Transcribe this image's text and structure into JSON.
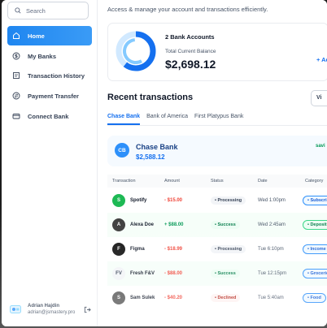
{
  "sidebar": {
    "search_placeholder": "Search",
    "items": [
      {
        "label": "Home",
        "icon": "home-icon"
      },
      {
        "label": "My Banks",
        "icon": "dollar-circle-icon"
      },
      {
        "label": "Transaction History",
        "icon": "receipt-icon"
      },
      {
        "label": "Payment Transfer",
        "icon": "transfer-icon"
      },
      {
        "label": "Connect Bank",
        "icon": "bank-card-icon"
      }
    ],
    "user": {
      "name": "Adrian Hajdin",
      "email": "adrian@jsmastery.pro"
    }
  },
  "header": {
    "subtitle": "Access & manage your account and transactions efficiently."
  },
  "balance_card": {
    "accounts_label": "2 Bank Accounts",
    "total_label": "Total Current Balance",
    "total": "$2,698.12",
    "add_bank": "+ Add"
  },
  "recent": {
    "title": "Recent transactions",
    "view_all": "Vi",
    "tabs": [
      "Chase Bank",
      "Bank of America",
      "First Platypus Bank"
    ],
    "bank": {
      "initials": "CB",
      "name": "Chase Bank",
      "balance": "$2,588.12",
      "type": "savi"
    },
    "columns": [
      "Transaction",
      "Amount",
      "Status",
      "Date",
      "Category"
    ],
    "rows": [
      {
        "name": "Spotify",
        "amount": "- $15.00",
        "status": "• Processing",
        "date": "Wed 1:00pm",
        "category": "• Subscrip",
        "avatar": "S",
        "avatar_color": "#1db954"
      },
      {
        "name": "Alexa Doe",
        "amount": "+ $88.00",
        "status": "• Success",
        "date": "Wed 2:45am",
        "category": "• Deposit",
        "avatar": "A",
        "avatar_color": "#3a3a3a"
      },
      {
        "name": "Figma",
        "amount": "- $18.99",
        "status": "• Processing",
        "date": "Tue 6:10pm",
        "category": "• Income",
        "avatar": "F",
        "avatar_color": "#111111"
      },
      {
        "name": "Fresh F&V",
        "amount": "- $88.00",
        "status": "• Success",
        "date": "Tue 12:15pm",
        "category": "• Groceries",
        "avatar": "FV",
        "avatar_color": "#f2f4f7"
      },
      {
        "name": "Sam Sulek",
        "amount": "- $40.20",
        "status": "• Declined",
        "date": "Tue 5:40am",
        "category": "• Food",
        "avatar": "S",
        "avatar_color": "#5a5a5a"
      }
    ]
  },
  "colors": {
    "accent": "#1570ef",
    "donut_outer": "#1570ef",
    "donut_inner": "#84caff"
  }
}
